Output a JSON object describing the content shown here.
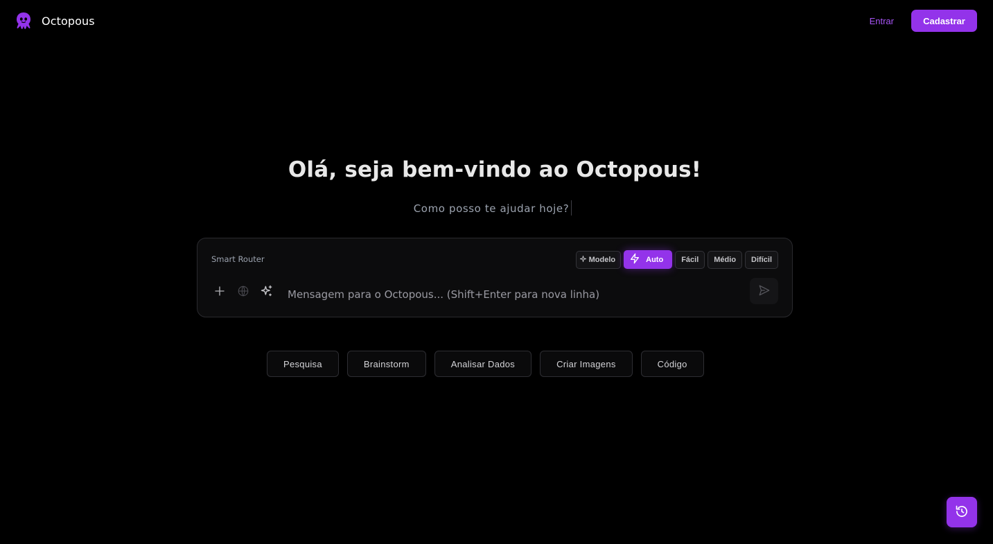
{
  "header": {
    "brand_name": "Octopous",
    "login_label": "Entrar",
    "signup_label": "Cadastrar"
  },
  "hero": {
    "title": "Olá, seja bem-vindo ao Octopous!",
    "subtitle": "Como posso te ajudar hoje?"
  },
  "composer": {
    "router_label": "Smart Router",
    "modes": {
      "model": "Modelo",
      "auto": "Auto",
      "easy": "Fácil",
      "medium": "Médio",
      "hard": "Difícil"
    },
    "active_mode": "Auto",
    "input_placeholder": "Mensagem para o Octopous... (Shift+Enter para nova linha)",
    "icons": [
      "plus-icon",
      "globe-icon",
      "sparkles-icon",
      "send-icon"
    ]
  },
  "suggestions": [
    "Pesquisa",
    "Brainstorm",
    "Analisar Dados",
    "Criar Imagens",
    "Código"
  ],
  "colors": {
    "accent": "#9333ea",
    "accent_text": "#a855f7",
    "background": "#000000",
    "card": "#0c0c0d"
  }
}
